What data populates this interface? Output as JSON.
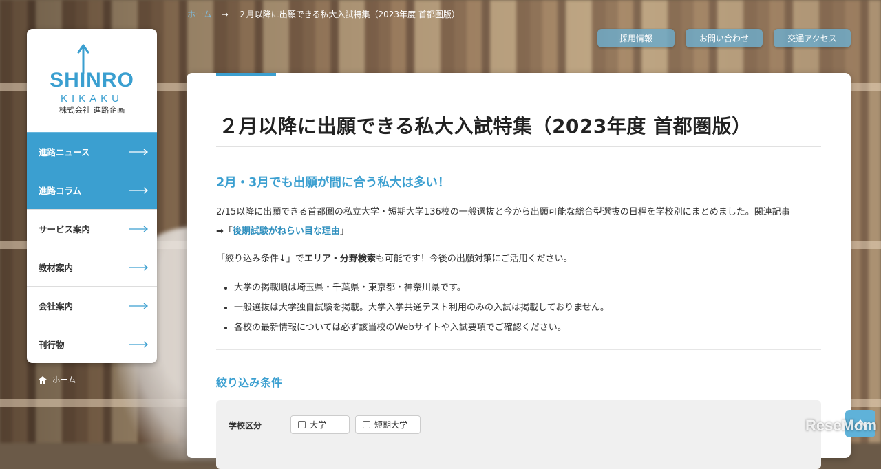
{
  "breadcrumb": {
    "home": "ホーム",
    "separator": "→",
    "current": "２月以降に出願できる私大入試特集（2023年度 首都圏版）"
  },
  "top_buttons": [
    "採用情報",
    "お問い合わせ",
    "交通アクセス"
  ],
  "logo": {
    "main": "SHINRO",
    "sub": "KIKAKU",
    "company": "株式会社 進路企画"
  },
  "sidebar": {
    "items": [
      {
        "label": "進路ニュース",
        "active": true
      },
      {
        "label": "進路コラム",
        "active": true
      },
      {
        "label": "サービス案内",
        "active": false
      },
      {
        "label": "教材案内",
        "active": false
      },
      {
        "label": "会社案内",
        "active": false
      },
      {
        "label": "刊行物",
        "active": false
      }
    ],
    "home_label": "ホーム"
  },
  "main": {
    "title": "２月以降に出願できる私大入試特集（2023年度 首都圏版）",
    "sub_heading": "2月・3月でも出願が間に合う私大は多い！",
    "para1_text": "2/15以降に出願できる首都圏の私立大学・短期大学136校の一般選抜と今から出願可能な総合型選抜の日程を学校別にまとめました。関連記事",
    "para1_arrow": "➡「",
    "para1_link": "後期試験がねらい目な理由",
    "para1_close": "」",
    "para2_pre": "「絞り込み条件↓」で",
    "para2_bold": "エリア・分野検索",
    "para2_post": "も可能です！今後の出願対策にご活用ください。",
    "bullets": [
      "大学の掲載順は埼玉県・千葉県・東京都・神奈川県です。",
      "一般選抜は大学独自試験を掲載。大学入学共通テスト利用のみの入試は掲載しておりません。",
      "各校の最新情報については必ず該当校のWebサイトや入試要項でご確認ください。"
    ],
    "filter_heading": "絞り込み条件",
    "filter": {
      "label": "学校区分",
      "options": [
        "大学",
        "短期大学"
      ]
    }
  },
  "watermark": "ReseMom",
  "colors": {
    "accent": "#3b9fd0"
  }
}
